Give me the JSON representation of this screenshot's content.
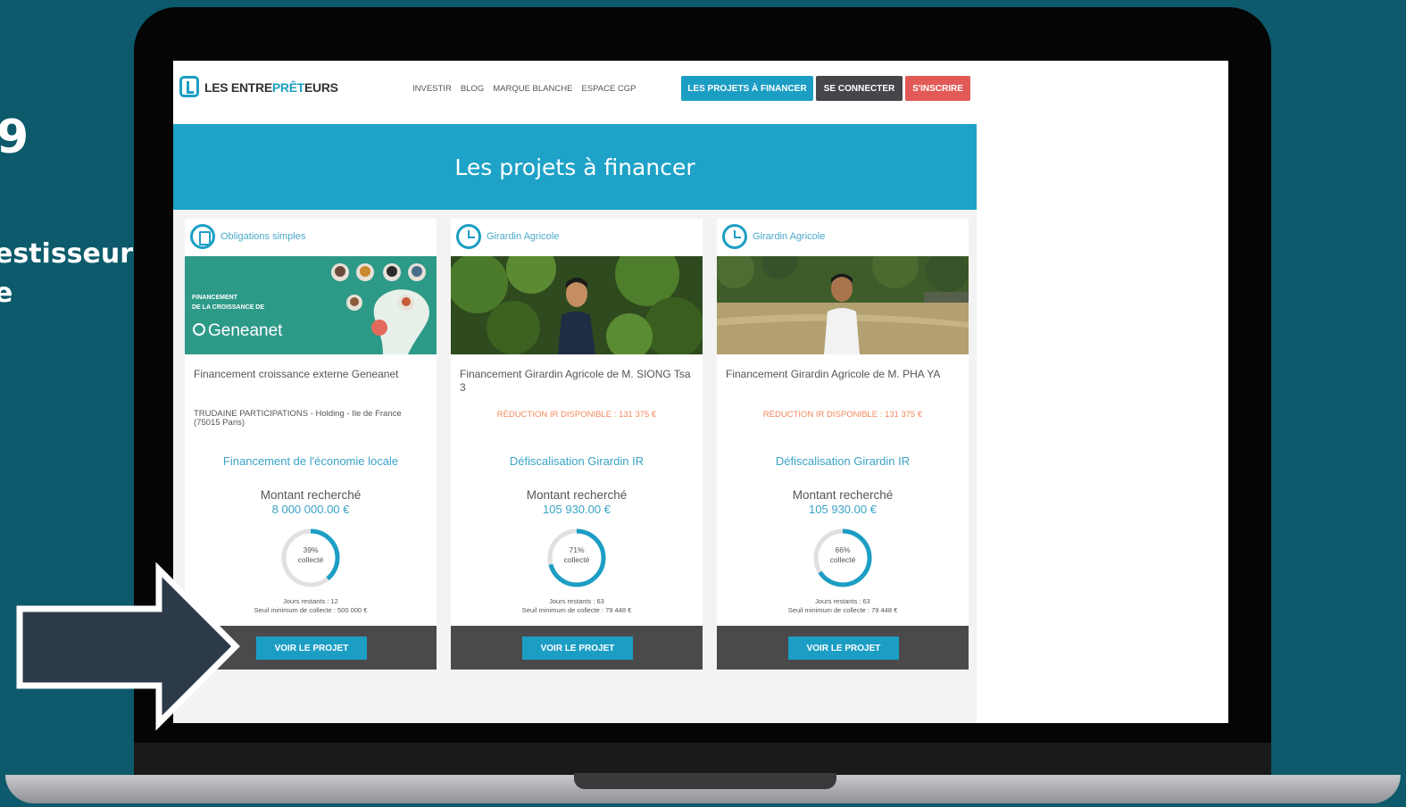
{
  "slide": {
    "big_text": "9",
    "line1": "estisseur",
    "line2": "e"
  },
  "header": {
    "logo_part1": "LES ENTRE",
    "logo_accent": "PRÊT",
    "logo_part2": "EURS",
    "nav": [
      "INVESTIR",
      "BLOG",
      "MARQUE BLANCHE",
      "ESPACE CGP"
    ],
    "btn_projects": "LES PROJETS À FINANCER",
    "btn_login": "SE CONNECTER",
    "btn_signup": "S'INSCRIRE"
  },
  "banner": {
    "title": "Les projets à financer"
  },
  "cards": [
    {
      "category": "Obligations simples",
      "category_icon": "document-icon",
      "title": "Financement croissance externe Geneanet",
      "company": "TRUDAINE PARTICIPATIONS - Holding - Ile de France (75015 Paris)",
      "kind": "Financement de l'économie locale",
      "amount_label": "Montant recherché",
      "amount": "8 000 000.00 €",
      "percent": "39%",
      "collected_label": "collecté",
      "progress": 0.39,
      "days_left": "Jours restants : 12",
      "min_threshold": "Seuil minimum de collecte : 500 000 €",
      "button": "VOIR LE PROJET",
      "image_caption": "FINANCEMENT DE LA CROISSANCE DE",
      "image_brand": "Geneanet"
    },
    {
      "category": "Girardin Agricole",
      "category_icon": "clock-icon",
      "title": "Financement Girardin Agricole de M. SIONG Tsa 3",
      "tax": "RÉDUCTION IR DISPONIBLE : 131 375 €",
      "kind": "Défiscalisation Girardin IR",
      "amount_label": "Montant recherché",
      "amount": "105 930.00 €",
      "percent": "71%",
      "collected_label": "collecté",
      "progress": 0.71,
      "days_left": "Jours restants : 63",
      "min_threshold": "Seuil minimum de collecte : 79 448 €",
      "button": "VOIR LE PROJET"
    },
    {
      "category": "Girardin Agricole",
      "category_icon": "clock-icon",
      "title": "Financement Girardin Agricole de M. PHA YA",
      "tax": "RÉDUCTION IR DISPONIBLE : 131 375 €",
      "kind": "Défiscalisation Girardin IR",
      "amount_label": "Montant recherché",
      "amount": "105 930.00 €",
      "percent": "66%",
      "collected_label": "collecté",
      "progress": 0.66,
      "days_left": "Jours restants : 63",
      "min_threshold": "Seuil minimum de collecte : 79 448 €",
      "button": "VOIR LE PROJET"
    }
  ],
  "colors": {
    "background": "#0c5a6b",
    "accent": "#1c9ec4",
    "signup": "#e15a58",
    "tax_orange": "#f2895c",
    "arrow_fill": "#2d3a4a"
  }
}
